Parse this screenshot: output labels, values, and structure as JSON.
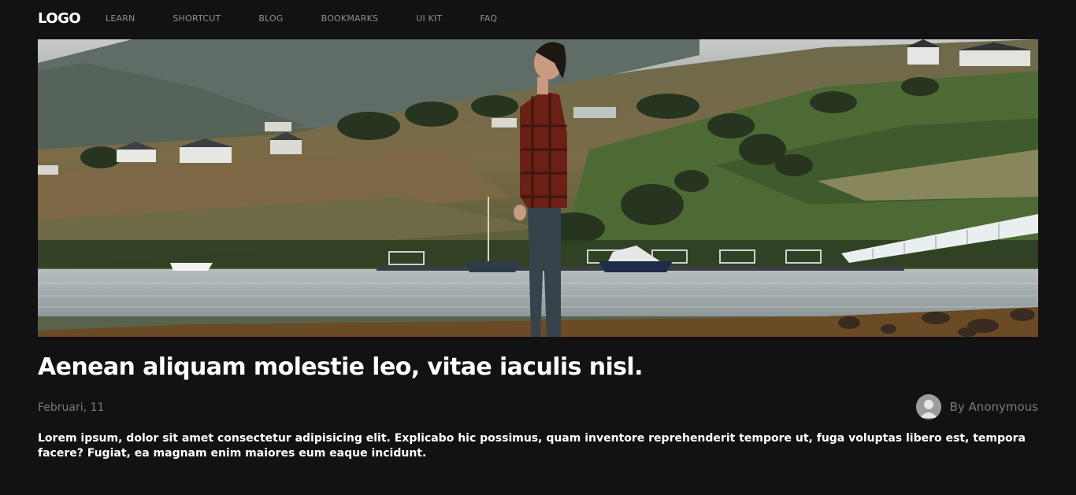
{
  "nav": {
    "logo": "LOGO",
    "items": [
      {
        "label": "LEARN"
      },
      {
        "label": "SHORTCUT"
      },
      {
        "label": "BLOG"
      },
      {
        "label": "BOOKMARKS"
      },
      {
        "label": "UI KIT"
      },
      {
        "label": "FAQ"
      }
    ]
  },
  "post": {
    "title": "Aenean aliquam molestie leo, vitae iaculis nisl.",
    "date": "Februari, 11",
    "author": "By Anonymous",
    "excerpt": "Lorem ipsum, dolor sit amet consectetur adipisicing elit. Explicabo hic possimus, quam inventore reprehenderit tempore ut, fuga voluptas libero est, tempora facere? Fugiat, ea magnam enim maiores eum eaque incidunt."
  },
  "colors": {
    "background": "#121212",
    "text": "#ffffff",
    "muted": "#7a7a7a",
    "nav_link": "#8e8e8e"
  }
}
